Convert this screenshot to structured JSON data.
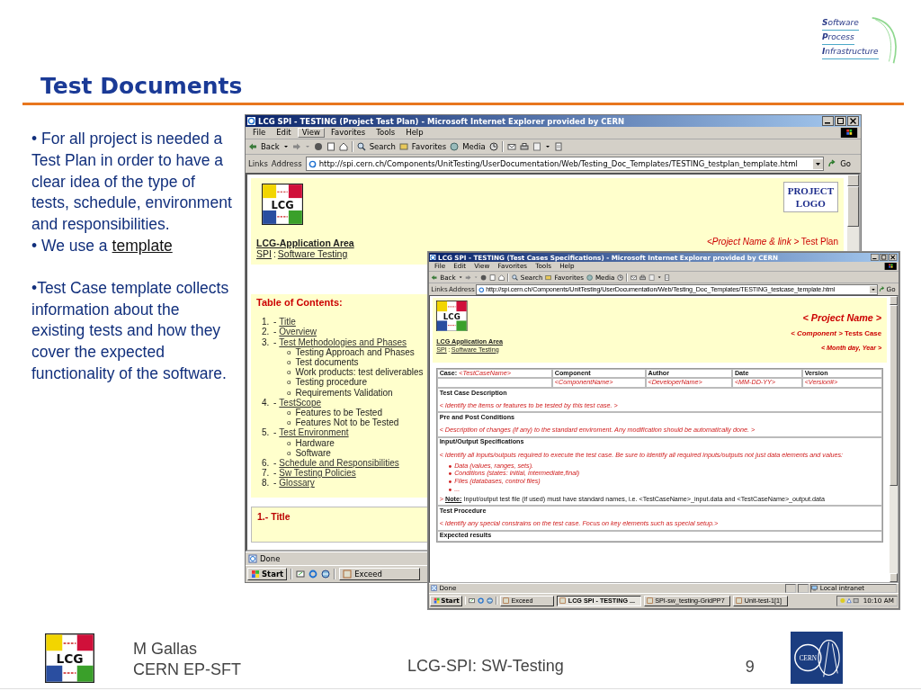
{
  "header": {
    "title": "Test Documents",
    "spi_logo": [
      "**S**oftware",
      "**P**rocess",
      "**I**nfrastructure"
    ]
  },
  "bullet_groups": [
    {
      "items": [
        {
          "text": "• For all project is needed a Test Plan in order to have a clear idea of the type of tests, schedule, environment and responsibilities."
        },
        {
          "text": "• We use a",
          "link": "template"
        }
      ]
    },
    {
      "items": [
        {
          "text": "•Test Case template collects information about the existing tests and how they cover the expected functionality of the software."
        }
      ]
    }
  ],
  "windows": [
    {
      "kind": "test_plan",
      "title": "LCG SPI - TESTING (Project Test Plan) - Microsoft Internet Explorer provided by CERN",
      "menus": [
        {
          "label": "File",
          "selected": false
        },
        {
          "label": "Edit",
          "selected": false
        },
        {
          "label": "View",
          "selected": true
        },
        {
          "label": "Favorites",
          "selected": false
        },
        {
          "label": "Tools",
          "selected": false
        },
        {
          "label": "Help",
          "selected": false
        }
      ],
      "toolbar": [
        "Back",
        "Search",
        "Favorites",
        "Media"
      ],
      "links_label": "Links",
      "address_label": "Address",
      "url": "http://spi.cern.ch/Components/UnitTesting/UserDocumentation/Web/Testing_Doc_Templates/TESTING_testplan_template.html",
      "go": "Go",
      "page": {
        "logo": "LCG",
        "project_logo": [
          "PROJECT",
          "LOGO"
        ],
        "project_line": "*<Project Name & link >* Test Plan",
        "area": "LCG-Application Area",
        "spi_link": "SPI",
        "separator": ":",
        "page_link": "Software Testing",
        "toc_title": "Table of Contents:",
        "toc": [
          {
            "number": "1.",
            "dash": "-",
            "link": "Title"
          },
          {
            "number": "2.",
            "dash": "-",
            "link": "Overview"
          },
          {
            "number": "3.",
            "dash": "-",
            "link": "Test Methodologies and Phases",
            "children": [
              {
                "marker": "o",
                "text": "Testing Approach and Phases"
              },
              {
                "marker": "o",
                "text": "Test documents"
              },
              {
                "marker": "o",
                "text": "Work products: test deliverables"
              },
              {
                "marker": "o",
                "text": "Testing procedure"
              },
              {
                "marker": "o",
                "text": "Requirements Validation"
              }
            ]
          },
          {
            "number": "4.",
            "dash": "-",
            "link": "TestScope",
            "children": [
              {
                "marker": "o",
                "text": "Features to be Tested"
              },
              {
                "marker": "o",
                "text": "Features Not to be Tested"
              }
            ]
          },
          {
            "number": "5.",
            "dash": "-",
            "link": "Test Environment",
            "children": [
              {
                "marker": "o",
                "text": "Hardware"
              },
              {
                "marker": "o",
                "text": "Software"
              }
            ]
          },
          {
            "number": "6.",
            "dash": "-",
            "link": "Schedule and Responsibilities"
          },
          {
            "number": "7.",
            "dash": "-",
            "link": "Sw Testing Policies"
          },
          {
            "number": "8.",
            "dash": "-",
            "link": "Glossary"
          }
        ],
        "section": "1.- Title"
      },
      "status": {
        "text": "Done"
      },
      "taskbar": {
        "start": "Start",
        "tasks": [
          {
            "label": "Exceed",
            "selected": false
          }
        ]
      }
    },
    {
      "kind": "test_case",
      "title": "LCG SPI - TESTING (Test Cases Specifications) - Microsoft Internet Explorer provided by CERN",
      "menus": [
        {
          "label": "File",
          "selected": false
        },
        {
          "label": "Edit",
          "selected": false
        },
        {
          "label": "View",
          "selected": false
        },
        {
          "label": "Favorites",
          "selected": false
        },
        {
          "label": "Tools",
          "selected": false
        },
        {
          "label": "Help",
          "selected": false
        }
      ],
      "toolbar": [
        "Back",
        "Search",
        "Favorites",
        "Media"
      ],
      "links_label": "Links",
      "address_label": "Address",
      "url": "http://spi.cern.ch/Components/UnitTesting/UserDocumentation/Web/Testing_Doc_Templates/TESTING_testcase_template.html",
      "go": "Go",
      "page": {
        "logo": "LCG",
        "project": "< Project Name >",
        "component_line": "*< Component >* Tests Case",
        "date": "< Month day, Year >",
        "area": "LCG Application Area",
        "spi_link": "SPI",
        "separator": ":",
        "page_link": "Software Testing",
        "table": {
          "case_label": "Case:",
          "case_value": "<TestCaseName>",
          "columns": [
            "Component",
            "Author",
            "Date",
            "Version"
          ],
          "values": [
            "<ComponentName>",
            "<DeveloperName>",
            "<MM-DD-YY>",
            "<Version#>"
          ]
        },
        "sections": [
          {
            "heading": "Test Case Description",
            "body": "< Identify the items or features to be tested by this test case. >"
          },
          {
            "heading": "Pre and Post Conditions",
            "body": "< Description of changes (if any) to the standard enviroment. Any modification should be automatically done. >"
          },
          {
            "heading": "Input/Output Specifications",
            "body": "< Identify all inputs/outputs required to execute the test case. Be sure to identify all required inputs/outputs not just data elements and values:",
            "list": [
              "Data (values, ranges, sets).",
              "Conditions (states: initial, intermediate,final)",
              "Files (databases, control files)",
              "..."
            ],
            "note": {
              "mark": ">",
              "label": "Note:",
              "text": "Input/output test file (if used) must have standard names, i.e. <TestCaseName>_input.data and <TestCaseName>_output.data"
            }
          },
          {
            "heading": "Test Procedure",
            "body": "< Identify any special constrains on the test case. Focus on key elements such as special setup.>"
          },
          {
            "heading": "Expected results"
          }
        ]
      },
      "status": {
        "text": "Done",
        "zone": "Local intranet"
      },
      "taskbar": {
        "start": "Start",
        "tasks": [
          {
            "label": "Exceed",
            "selected": false
          },
          {
            "label": "LCG SPI - TESTING ...",
            "selected": true
          },
          {
            "label": "SPI-sw_testing-GridPP7",
            "selected": false
          },
          {
            "label": "Unit-test-1[1]",
            "selected": false
          }
        ],
        "clock": "10:10 AM"
      }
    }
  ],
  "footer": {
    "logo": "LCG",
    "author": [
      "M Gallas",
      "CERN EP-SFT"
    ],
    "center": "LCG-SPI: SW-Testing",
    "page": "9",
    "cern_logo": "CERN"
  }
}
